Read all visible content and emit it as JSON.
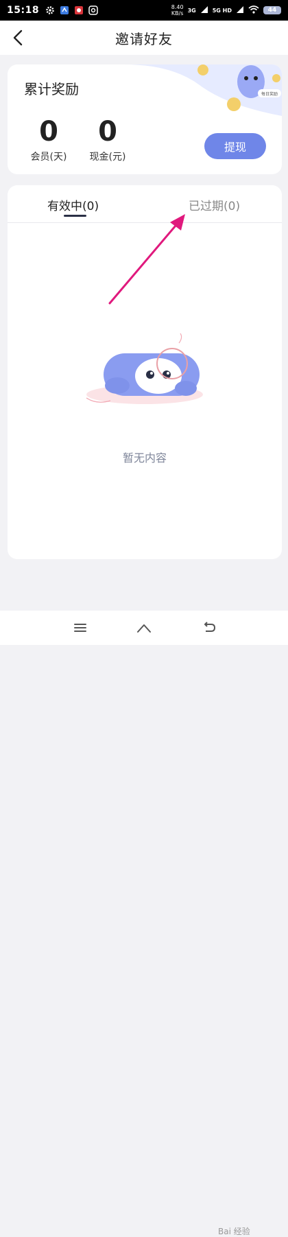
{
  "status_bar": {
    "time": "15:18",
    "speed_value": "8.40",
    "speed_unit": "KB/s",
    "net1": "3G",
    "net2": "5G HD",
    "battery": "44"
  },
  "header": {
    "title": "邀请好友"
  },
  "reward_card": {
    "title": "累计奖励",
    "member_value": "0",
    "member_label": "会员(天)",
    "cash_value": "0",
    "cash_label": "现金(元)",
    "withdraw_label": "提现",
    "banner_badge": "每日奖励"
  },
  "tabs": [
    {
      "label": "有效中(0)",
      "active": true
    },
    {
      "label": "已过期(0)",
      "active": false
    }
  ],
  "empty_state": {
    "text": "暂无内容"
  },
  "watermark": "Bai 经验",
  "colors": {
    "accent": "#6f86e8",
    "annotation": "#e0197d",
    "mascot": "#8a9cf0"
  }
}
